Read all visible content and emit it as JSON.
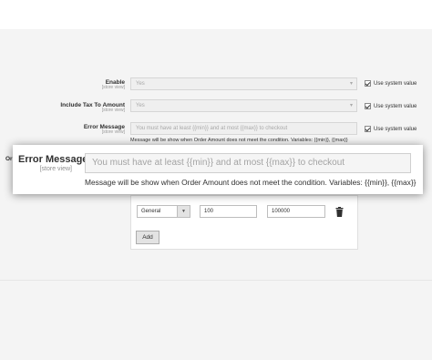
{
  "rows": [
    {
      "label": "Enable",
      "scope": "[store view]",
      "value": "Yes",
      "use_system_value": "Use system value"
    },
    {
      "label": "Include Tax To Amount",
      "scope": "[store view]",
      "value": "Yes",
      "use_system_value": "Use system value"
    },
    {
      "label": "Error Message",
      "scope": "[store view]",
      "placeholder": "You must have at least {{min}} and at most {{max}} to checkout",
      "use_system_value": "Use system value"
    }
  ],
  "error_note": "Message will be show when Order Amount does not meet the condition. Variables: {{min}}, {{max}}",
  "partial_label": "Or",
  "table": {
    "group": "General",
    "min": "100",
    "max": "100000",
    "add_label": "Add"
  },
  "zoom": {
    "label": "Error Message",
    "scope": "[store view]",
    "placeholder": "You must have at least {{min}} and at most {{max}} to checkout",
    "note": "Message will be show when Order Amount does not meet the condition. Variables: {{min}}, {{max}}"
  },
  "icons": {
    "select_arrow": "chevron-down-icon",
    "delete": "trash-icon",
    "checkbox": "checkbox-checked-icon"
  }
}
